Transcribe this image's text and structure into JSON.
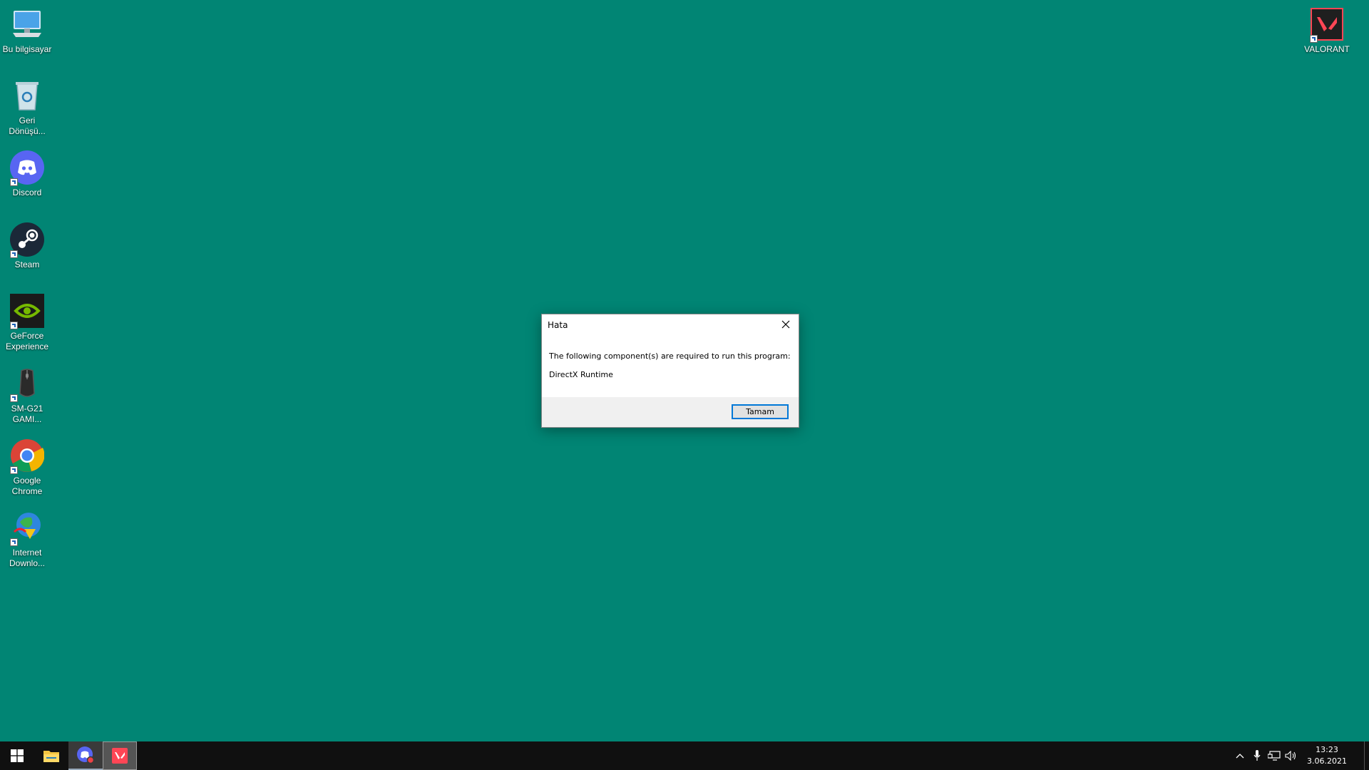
{
  "desktop": {
    "icons": [
      {
        "label": "Bu bilgisayar"
      },
      {
        "label": "Geri Dönüşü..."
      },
      {
        "label": "Discord"
      },
      {
        "label": "Steam"
      },
      {
        "label": "GeForce Experience"
      },
      {
        "label": "SM-G21 GAMI..."
      },
      {
        "label": "Google Chrome"
      },
      {
        "label": "Internet Downlo..."
      },
      {
        "label": "VALORANT"
      }
    ]
  },
  "dialog": {
    "title": "Hata",
    "message": "The following component(s) are required to run this program:",
    "component": "DirectX Runtime",
    "ok_label": "Tamam"
  },
  "taskbar": {
    "time": "13:23",
    "date": "3.06.2021"
  },
  "colors": {
    "desktop_bg": "#018574",
    "taskbar_bg": "#101010",
    "accent": "#0078d7",
    "valorant": "#ff4655",
    "discord": "#5865f2"
  }
}
